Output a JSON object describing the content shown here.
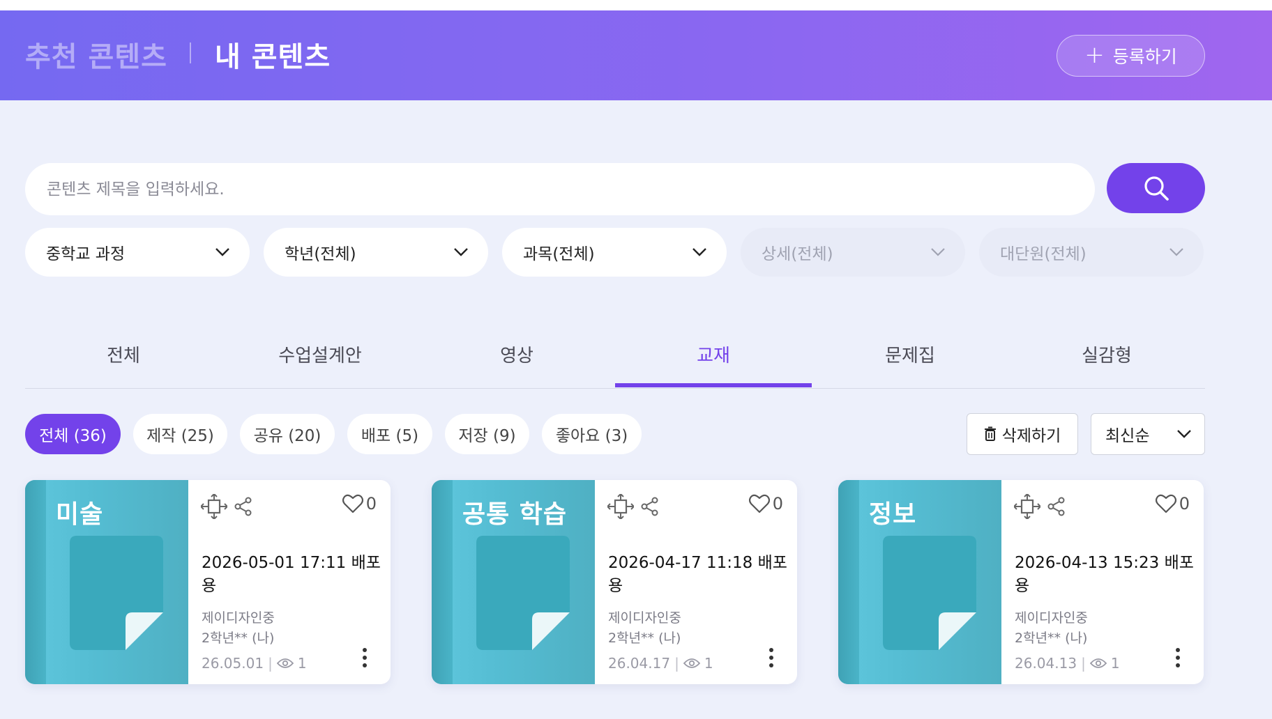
{
  "header": {
    "tab_recommended": "추천 콘텐츠",
    "tab_mine": "내 콘텐츠",
    "register_label": "등록하기"
  },
  "search": {
    "placeholder": "콘텐츠 제목을 입력하세요."
  },
  "filters": [
    {
      "label": "중학교 과정",
      "enabled": true
    },
    {
      "label": "학년(전체)",
      "enabled": true
    },
    {
      "label": "과목(전체)",
      "enabled": true
    },
    {
      "label": "상세(전체)",
      "enabled": false
    },
    {
      "label": "대단원(전체)",
      "enabled": false
    }
  ],
  "tabs": {
    "items": [
      "전체",
      "수업설계안",
      "영상",
      "교재",
      "문제집",
      "실감형"
    ],
    "active": "교재"
  },
  "chips": [
    "전체 (36)",
    "제작 (25)",
    "공유 (20)",
    "배포 (5)",
    "저장 (9)",
    "좋아요 (3)"
  ],
  "actions": {
    "delete_label": "삭제하기",
    "sort_label": "최신순"
  },
  "cards": [
    {
      "subject": "미술",
      "title": "2026-05-01 17:11 배포용",
      "title_line1": "2026-05-01 17:11 배포",
      "title_line2": "용",
      "school": "제이디자인중",
      "class": "2학년** (나)",
      "date": "26.05.01",
      "views": "1",
      "likes": "0"
    },
    {
      "subject": "공통 학습",
      "title": "2026-04-17 11:18 배포용",
      "title_line1": "2026-04-17 11:18 배포",
      "title_line2": "용",
      "school": "제이디자인중",
      "class": "2학년** (나)",
      "date": "26.04.17",
      "views": "1",
      "likes": "0"
    },
    {
      "subject": "정보",
      "title": "2026-04-13 15:23 배포용",
      "title_line1": "2026-04-13 15:23 배포",
      "title_line2": "용",
      "school": "제이디자인중",
      "class": "2학년** (나)",
      "date": "26.04.13",
      "views": "1",
      "likes": "0"
    }
  ],
  "colors": {
    "accent": "#7342ea",
    "header_start": "#7569f1",
    "header_end": "#a066ef",
    "background": "#edf0fb",
    "card_thumb": "#55bdd3"
  }
}
